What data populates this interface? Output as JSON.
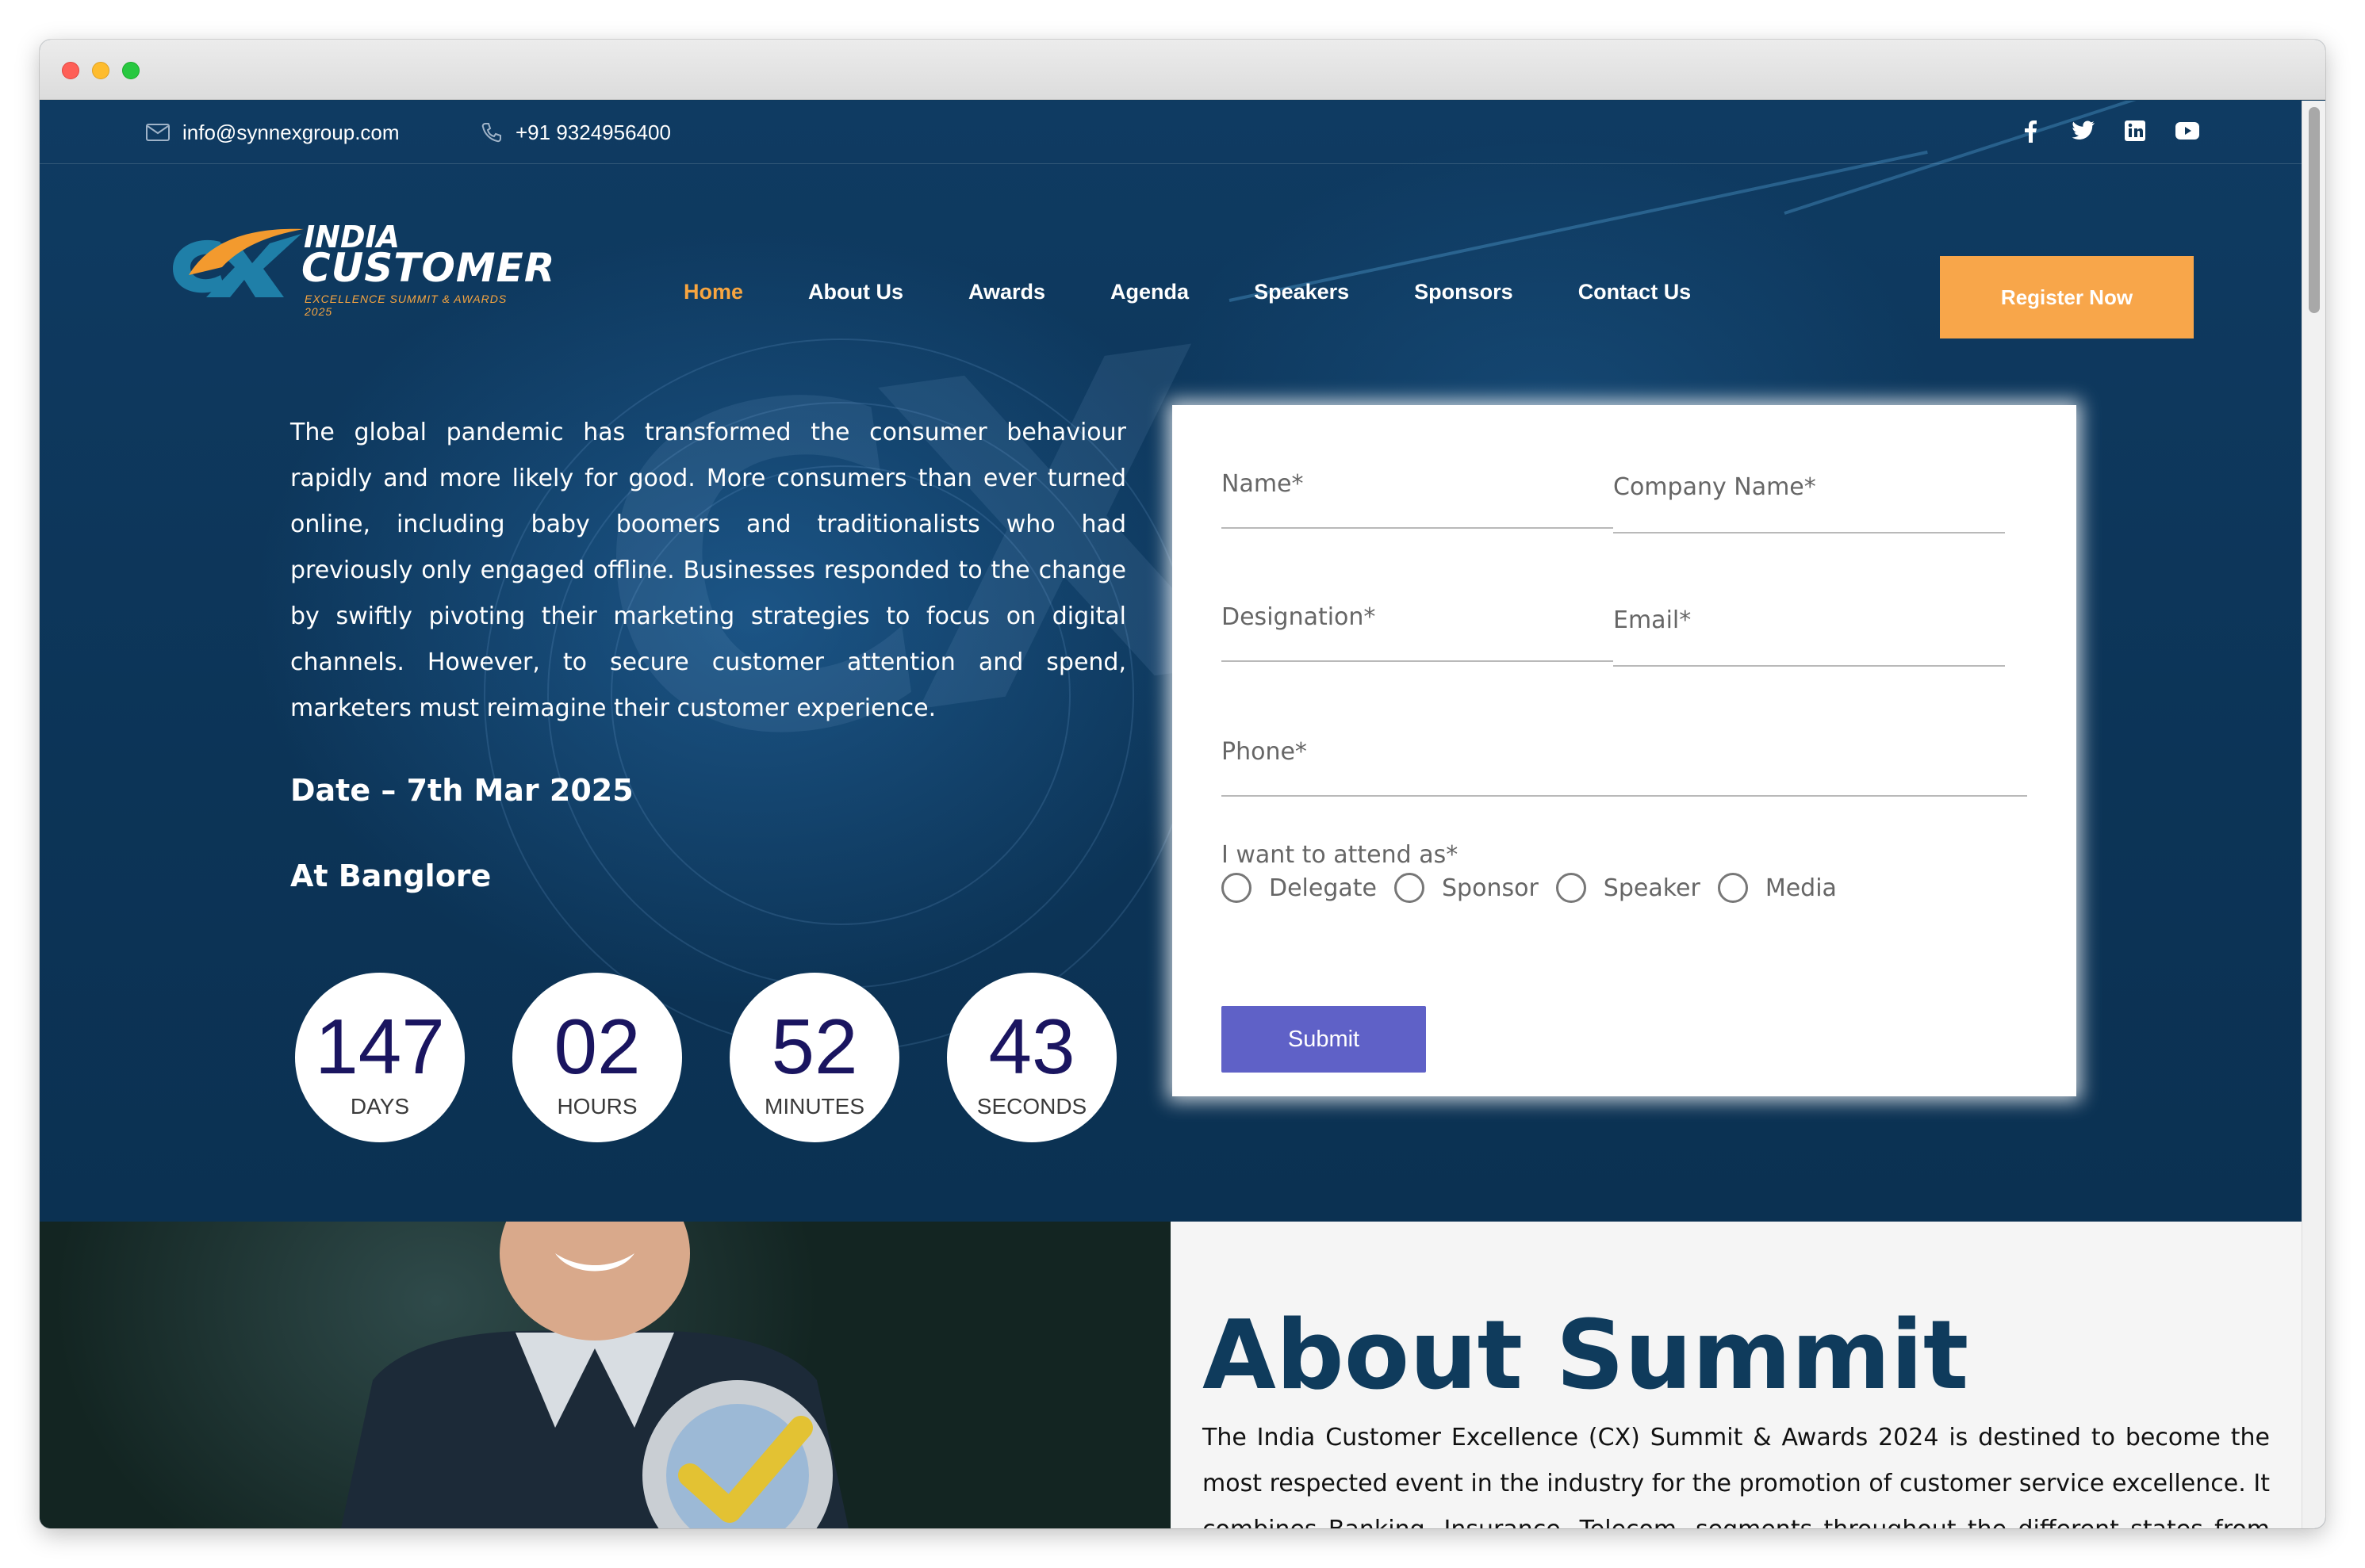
{
  "topbar": {
    "email": "info@synnexgroup.com",
    "phone": "+91 9324956400",
    "social_icons": [
      "facebook-icon",
      "twitter-icon",
      "linkedin-icon",
      "youtube-icon"
    ]
  },
  "logo": {
    "line1": "INDIA",
    "line2": "CUSTOMER",
    "tagline": "EXCELLENCE SUMMIT & AWARDS 2025",
    "mark": "CX"
  },
  "nav": {
    "items": [
      "Home",
      "About Us",
      "Awards",
      "Agenda",
      "Speakers",
      "Sponsors",
      "Contact Us"
    ],
    "active": "Home",
    "register_label": "Register Now"
  },
  "hero": {
    "intro": "The global pandemic has transformed the consumer behaviour rapidly and more likely for good. More consumers than ever turned online, including baby boomers and traditionalists who had previously only engaged offline. Businesses responded to the change by swiftly pivoting their marketing strategies to focus on digital channels. However, to secure customer attention and spend, marketers must reimagine their customer experience.",
    "date": "Date – 7th Mar 2025",
    "place": "At Banglore"
  },
  "countdown": [
    {
      "value": "147",
      "label": "DAYS"
    },
    {
      "value": "02",
      "label": "HOURS"
    },
    {
      "value": "52",
      "label": "MINUTES"
    },
    {
      "value": "43",
      "label": "SECONDS"
    }
  ],
  "form": {
    "name_placeholder": "Name*",
    "company_placeholder": "Company Name*",
    "designation_placeholder": "Designation*",
    "email_placeholder": "Email*",
    "phone_placeholder": "Phone*",
    "attend_label": "I want to attend as*",
    "options": [
      "Delegate",
      "Sponsor",
      "Speaker",
      "Media"
    ],
    "submit_label": "Submit"
  },
  "about": {
    "title": "About Summit",
    "body": "The India Customer Excellence (CX) Summit & Awards 2024 is destined to become the most respected event in the industry for the promotion of customer service excellence. It combines Banking, Insurance, Telecom, segments throughout the different states from India into a single"
  },
  "colors": {
    "accent": "#f8a64a",
    "navy": "#0d3558",
    "submit": "#5f61c7",
    "title": "#0f3b5c"
  }
}
